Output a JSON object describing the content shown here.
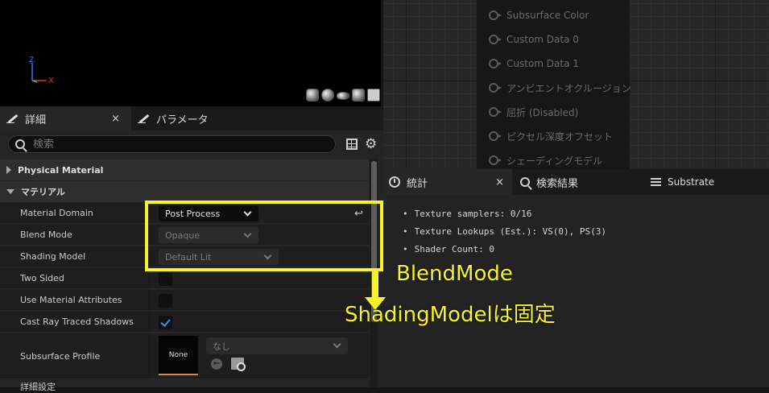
{
  "viewport": {
    "axis_z": "Z",
    "axis_x": "X",
    "preview_shapes": [
      "sphere-icon",
      "sphere-icon",
      "plane-icon",
      "cylinder-icon",
      "cube-icon"
    ]
  },
  "graph_node": {
    "pins": [
      "Subsurface Color",
      "Custom Data 0",
      "Custom Data 1",
      "アンビエントオクルージョン",
      "屈折 (Disabled)",
      "ピクセル深度オフセット",
      "シェーディングモデル"
    ]
  },
  "details": {
    "tabs": [
      {
        "label": "詳細",
        "icon": "pencil-icon",
        "close": "×"
      },
      {
        "label": "パラメータ",
        "icon": "pencil-icon"
      }
    ],
    "search_placeholder": "検索",
    "sections": {
      "physical_material": "Physical Material",
      "material": "マテリアル"
    },
    "properties": {
      "material_domain": {
        "label": "Material Domain",
        "value": "Post Process"
      },
      "blend_mode": {
        "label": "Blend Mode",
        "value": "Opaque"
      },
      "shading_model": {
        "label": "Shading Model",
        "value": "Default Lit"
      },
      "two_sided": {
        "label": "Two Sided",
        "checked": false
      },
      "use_material_attributes": {
        "label": "Use Material Attributes",
        "checked": false
      },
      "cast_ray_traced_shadows": {
        "label": "Cast Ray Traced Shadows",
        "checked": true
      },
      "subsurface_profile": {
        "label": "Subsurface Profile",
        "thumbnail": "None",
        "value": "なし"
      }
    },
    "cut_row_label": "詳細設定"
  },
  "stats": {
    "tabs": [
      {
        "label": "統計",
        "icon": "stats-icon",
        "close": "×"
      },
      {
        "label": "検索結果",
        "icon": "search-icon"
      },
      {
        "label": "Substrate",
        "icon": "list-icon"
      }
    ],
    "lines": [
      "Texture samplers: 0/16",
      "Texture Lookups (Est.): VS(0), PS(3)",
      "Shader Count: 0"
    ]
  },
  "annotation": {
    "line1": "BlendMode",
    "line2": "ShadingModelは固定",
    "color": "#f5f528"
  }
}
